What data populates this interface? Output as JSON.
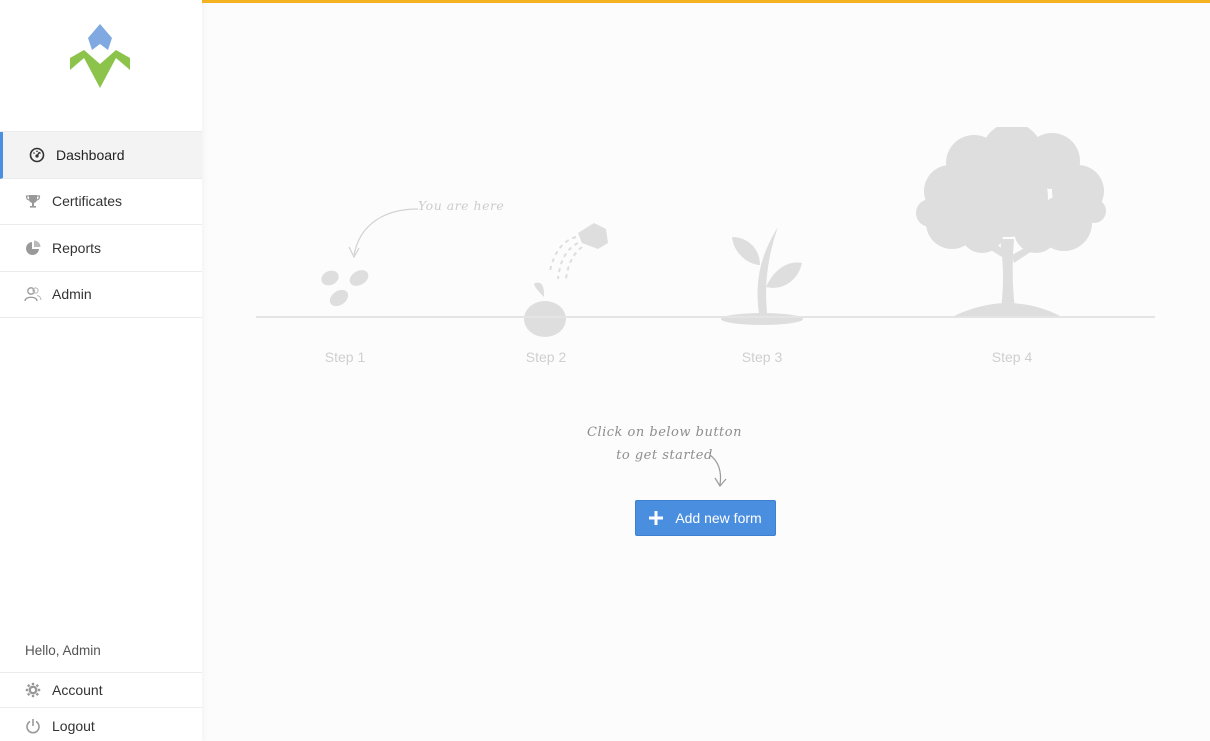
{
  "nav": {
    "items": [
      {
        "label": "Dashboard",
        "icon": "dashboard-icon",
        "active": true
      },
      {
        "label": "Certificates",
        "icon": "trophy-icon"
      },
      {
        "label": "Reports",
        "icon": "pie-chart-icon"
      },
      {
        "label": "Admin",
        "icon": "users-icon"
      }
    ]
  },
  "user": {
    "greeting": "Hello, Admin"
  },
  "bottom_nav": {
    "account_label": "Account",
    "logout_label": "Logout"
  },
  "steps": {
    "you_are_here": "You are here",
    "labels": [
      "Step 1",
      "Step 2",
      "Step 3",
      "Step 4"
    ]
  },
  "cta": {
    "hint_line1": "Click on below button",
    "hint_line2": "to get started",
    "button_label": "Add new form"
  },
  "colors": {
    "accent_bar": "#f5b324",
    "primary": "#4a8ee0",
    "logo_blue": "#7fa9e0",
    "logo_green": "#8cc34a",
    "illustration": "#dedede"
  }
}
